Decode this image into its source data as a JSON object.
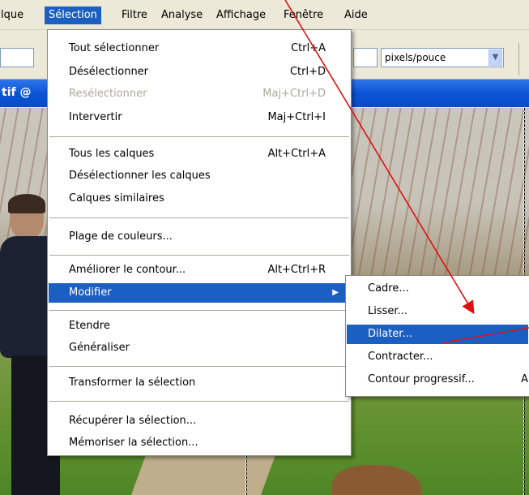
{
  "menubar": {
    "items": [
      {
        "label": "lque"
      },
      {
        "label": "Sélection"
      },
      {
        "label": "Filtre"
      },
      {
        "label": "Analyse"
      },
      {
        "label": "Affichage"
      },
      {
        "label": "Fenêtre"
      },
      {
        "label": "Aide"
      }
    ]
  },
  "options": {
    "resolution_unit": "pixels/pouce"
  },
  "document": {
    "title": "tif @"
  },
  "selection_menu": {
    "items": [
      {
        "label": "Tout sélectionner",
        "shortcut": "Ctrl+A"
      },
      {
        "label": "Désélectionner",
        "shortcut": "Ctrl+D"
      },
      {
        "label": "Resélectionner",
        "shortcut": "Maj+Ctrl+D"
      },
      {
        "label": "Intervertir",
        "shortcut": "Maj+Ctrl+I"
      },
      {
        "label": "Tous les calques",
        "shortcut": "Alt+Ctrl+A"
      },
      {
        "label": "Désélectionner les calques",
        "shortcut": ""
      },
      {
        "label": "Calques similaires",
        "shortcut": ""
      },
      {
        "label": "Plage de couleurs...",
        "shortcut": ""
      },
      {
        "label": "Améliorer le contour...",
        "shortcut": "Alt+Ctrl+R"
      },
      {
        "label": "Modifier",
        "shortcut": ""
      },
      {
        "label": "Etendre",
        "shortcut": ""
      },
      {
        "label": "Généraliser",
        "shortcut": ""
      },
      {
        "label": "Transformer la sélection",
        "shortcut": ""
      },
      {
        "label": "Récupérer la sélection...",
        "shortcut": ""
      },
      {
        "label": "Mémoriser la sélection...",
        "shortcut": ""
      }
    ]
  },
  "modifier_submenu": {
    "items": [
      {
        "label": "Cadre...",
        "shortcut": ""
      },
      {
        "label": "Lisser...",
        "shortcut": ""
      },
      {
        "label": "Dilater...",
        "shortcut": ""
      },
      {
        "label": "Contracter...",
        "shortcut": ""
      },
      {
        "label": "Contour progressif...",
        "shortcut": "A"
      }
    ]
  },
  "colors": {
    "highlight": "#1c5fc2",
    "annotation": "#e01010"
  }
}
